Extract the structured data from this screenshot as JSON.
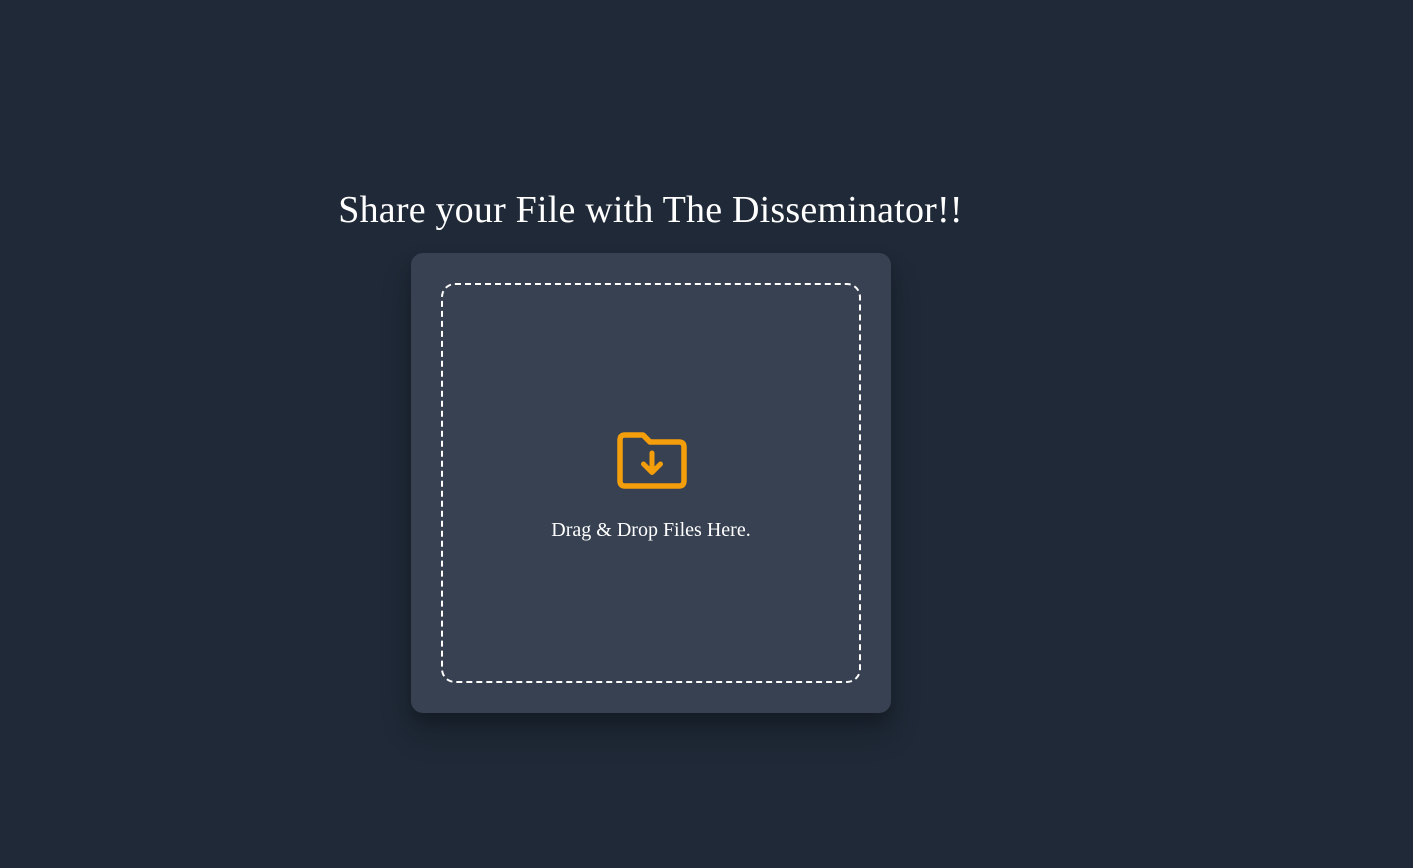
{
  "header": {
    "title": "Share your File with The Disseminator!!"
  },
  "dropzone": {
    "icon": "folder-download-icon",
    "label": "Drag & Drop Files Here."
  },
  "colors": {
    "background": "#1f2937",
    "card": "#374151",
    "accent": "#f59e0b",
    "text": "#ffffff"
  }
}
